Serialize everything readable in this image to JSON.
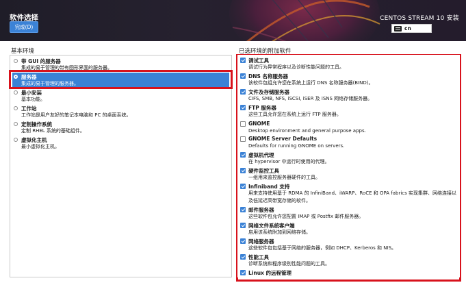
{
  "header": {
    "title": "软件选择",
    "done_label": "完成(D)",
    "product": "CENTOS STREAM 10 安装",
    "keyboard_layout": "cn"
  },
  "left": {
    "title": "基本环境",
    "environments": [
      {
        "name": "带 GUI 的服务器",
        "desc": "集成的易于管理的带有图形界面的服务器。",
        "selected": false
      },
      {
        "name": "服务器",
        "desc": "集成的易于管理的服务器。",
        "selected": true
      },
      {
        "name": "最小安装",
        "desc": "基本功能。",
        "selected": false
      },
      {
        "name": "工作站",
        "desc": "工作站是用户友好的笔记本电脑和 PC 的桌面系统。",
        "selected": false
      },
      {
        "name": "定制操作系统",
        "desc": "定制 RHEL 系统的基础组件。",
        "selected": false
      },
      {
        "name": "虚拟化主机",
        "desc": "最小虚拟化主机。",
        "selected": false
      }
    ]
  },
  "right": {
    "title": "已选环境的附加软件",
    "addons": [
      {
        "name": "调试工具",
        "desc": "调试行为异常程序以及诊断性能问题的工具。",
        "checked": true
      },
      {
        "name": "DNS 名称服务器",
        "desc": "该软件包组允许您在系统上运行 DNS 名称服务器(BIND)。",
        "checked": true
      },
      {
        "name": "文件及存储服务器",
        "desc": "CIFS, SMB, NFS, iSCSI, iSER 及 iSNS 网络存储服务器。",
        "checked": true
      },
      {
        "name": "FTP 服务器",
        "desc": "这些工具允许您在系统上运行 FTP 服务器。",
        "checked": true
      },
      {
        "name": "GNOME",
        "desc": "Desktop environment and general purpose apps.",
        "checked": false
      },
      {
        "name": "GNOME Server Defaults",
        "desc": "Defaults for running GNOME on servers.",
        "checked": false
      },
      {
        "name": "虚拟机代理",
        "desc": "在 hypervisor 中运行时使用的代理。",
        "checked": true
      },
      {
        "name": "硬件监控工具",
        "desc": "一组用来监控服务器硬件的工具。",
        "checked": true
      },
      {
        "name": "Infiniband 支持",
        "desc": "用来支持使用基于 RDMA 的 InfiniBand、iWARP、RoCE 和 OPA fabrics 实现集群、网络连接以及低延迟高带宽存储的软件。",
        "checked": true
      },
      {
        "name": "邮件服务器",
        "desc": "这些软件包允许您配置 IMAP 或 Postfix 邮件服务器。",
        "checked": true
      },
      {
        "name": "网络文件系统客户端",
        "desc": "启用该系统附加到网络存储。",
        "checked": true
      },
      {
        "name": "网络服务器",
        "desc": "这些软件包包括基于网络的服务器，例如 DHCP、Kerberos 和 NIS。",
        "checked": true
      },
      {
        "name": "性能工具",
        "desc": "诊断系统和程序级别性能问题的工具。",
        "checked": true
      },
      {
        "name": "Linux 的远程管理",
        "desc": "",
        "checked": true
      }
    ]
  },
  "colors": {
    "accent": "#3b82d6",
    "highlight_border": "#d8121c",
    "header_bg": "#23202c"
  }
}
